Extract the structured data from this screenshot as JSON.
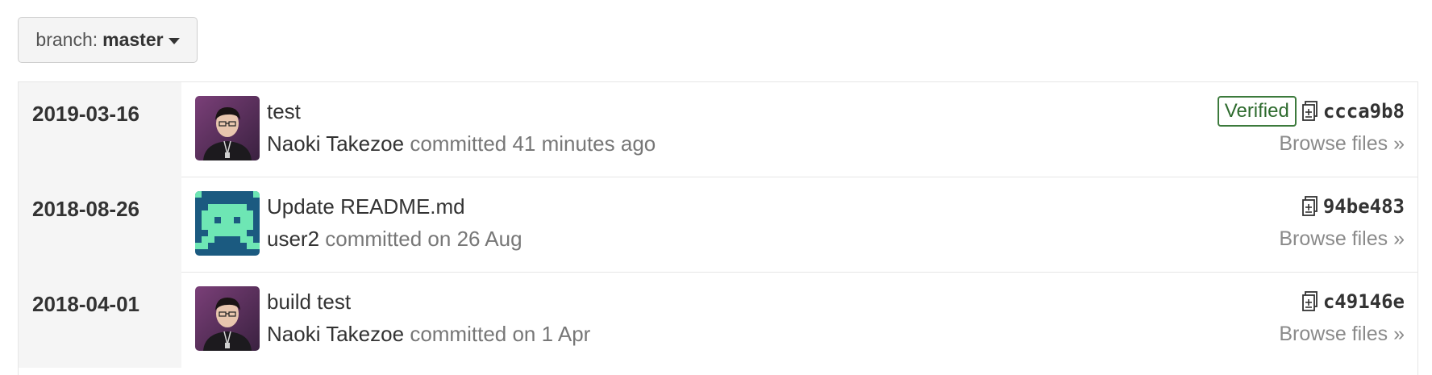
{
  "branch": {
    "prefix": "branch:",
    "name": "master"
  },
  "groups": [
    {
      "date": "2019-03-16",
      "commit": {
        "title": "test",
        "author": "Naoki Takezoe",
        "meta": "committed 41 minutes ago",
        "verified": "Verified",
        "sha": "ccca9b8",
        "browse": "Browse files »",
        "avatar": "person-photo"
      }
    },
    {
      "date": "2018-08-26",
      "commit": {
        "title": "Update README.md",
        "author": "user2",
        "meta": "committed on 26 Aug",
        "verified": "",
        "sha": "94be483",
        "browse": "Browse files »",
        "avatar": "identicon"
      }
    },
    {
      "date": "2018-04-01",
      "commit": {
        "title": "build test",
        "author": "Naoki Takezoe",
        "meta": "committed on 1 Apr",
        "verified": "",
        "sha": "c49146e",
        "browse": "Browse files »",
        "avatar": "person-photo"
      }
    }
  ],
  "icons": {
    "copy": "copy-clipboard-icon",
    "caret": "caret-down-icon"
  },
  "colors": {
    "verified": "#2e6b2e",
    "identicon_bg": "#1b5a80",
    "identicon_fg": "#6ee6b4"
  }
}
